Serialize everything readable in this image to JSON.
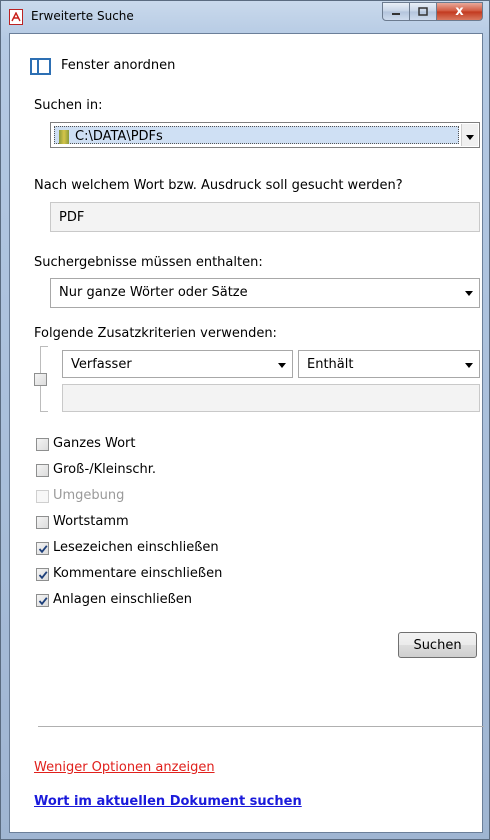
{
  "window": {
    "title": "Erweiterte Suche",
    "close_glyph": "x"
  },
  "arrange": {
    "label": "Fenster anordnen"
  },
  "search_in": {
    "label": "Suchen in:",
    "value": "C:\\DATA\\PDFs"
  },
  "query": {
    "label": "Nach welchem Wort bzw. Ausdruck soll gesucht werden?",
    "value": "PDF"
  },
  "match": {
    "label": "Suchergebnisse müssen enthalten:",
    "value": "Nur ganze Wörter oder Sätze"
  },
  "criteria": {
    "label": "Folgende Zusatzkriterien verwenden:",
    "field": "Verfasser",
    "operator": "Enthält",
    "value": ""
  },
  "options": [
    {
      "label": "Ganzes Wort",
      "checked": false,
      "disabled": false
    },
    {
      "label": "Groß-/Kleinschr.",
      "checked": false,
      "disabled": false
    },
    {
      "label": "Umgebung",
      "checked": false,
      "disabled": true
    },
    {
      "label": "Wortstamm",
      "checked": false,
      "disabled": false
    },
    {
      "label": "Lesezeichen einschließen",
      "checked": true,
      "disabled": false
    },
    {
      "label": "Kommentare einschließen",
      "checked": true,
      "disabled": false
    },
    {
      "label": "Anlagen einschließen",
      "checked": true,
      "disabled": false
    }
  ],
  "search_button": {
    "label": "Suchen"
  },
  "links": {
    "fewer_options": "Weniger Optionen anzeigen",
    "search_current": "Wort im aktuellen Dokument suchen"
  },
  "colors": {
    "link_red": "#e0201c",
    "link_blue": "#1a1adb",
    "close_button": "#c2381d",
    "selection": "#cfe0f4"
  }
}
